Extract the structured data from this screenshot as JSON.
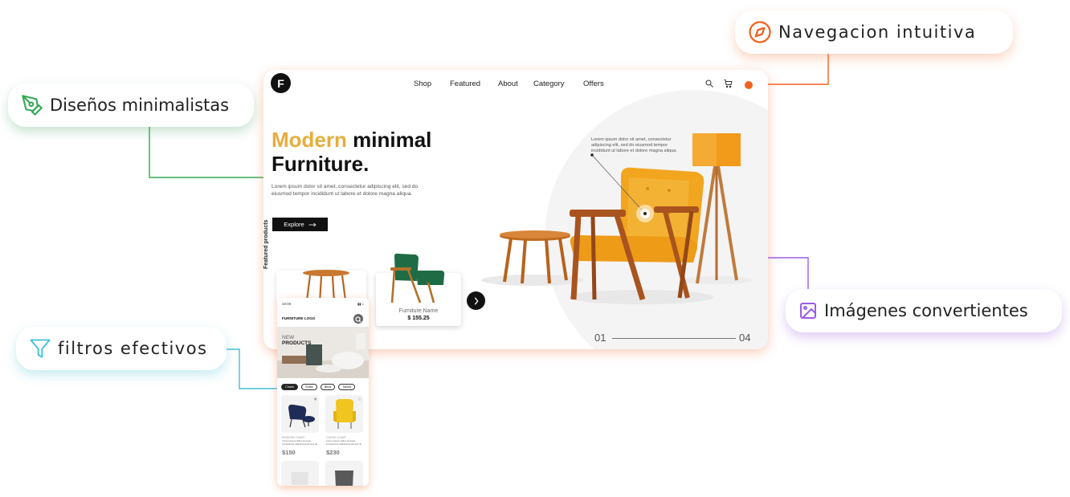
{
  "callouts": {
    "minimal": "Diseños minimalistas",
    "navigation": "Navegacion intuitiva",
    "images": "Imágenes convertientes",
    "filters": "filtros efectivos"
  },
  "colors": {
    "green": "#34a853",
    "orange": "#f2611f",
    "purple": "#9b5de5",
    "teal": "#3fc1d8",
    "gold": "#e6ad3c"
  },
  "desktop": {
    "logo": "F",
    "nav": [
      "Shop",
      "Featured",
      "About",
      "Category",
      "Offers"
    ],
    "hero": {
      "title_accent": "Modern",
      "title_rest": "minimal",
      "title_line2": "Furniture.",
      "description": "Lorem ipsum dolor sit amet, consectetur adipiscing elit, sed do eiusmod tempor incididunt ut labore et dolore magna aliqua.",
      "cta": "Explore"
    },
    "featured_label": "Featured products",
    "card": {
      "name": "Furniture Name",
      "price": "$ 155.25"
    },
    "note": "Lorem ipsum dolor sit amet, consectetur adipiscing elit, sed do eiusmod tempor incididunt ut labore et dolore magna aliqua.",
    "slide": {
      "current": "01",
      "total": "04"
    },
    "icons": [
      "logo-icon",
      "search-icon",
      "cart-icon",
      "chevron-right-icon",
      "arrow-right-icon"
    ]
  },
  "mobile": {
    "time": "10:00",
    "status_icons": "▮▮ ◖",
    "brand": "FURNITURE LOGO",
    "hero_line1": "NEW",
    "hero_line2": "PRODUCTS",
    "chips": [
      "Chairs",
      "Sofas",
      "Beds",
      "Tables"
    ],
    "products": [
      {
        "name": "MODERN CHAIR",
        "desc": "Lorem ipsum dolor sit amet, consectetur adipiscing elit sed do",
        "price": "$150"
      },
      {
        "name": "CURVE CHAIR",
        "desc": "Lorem ipsum dolor sit amet, consectetur adipiscing elit sed do",
        "price": "$230"
      }
    ]
  }
}
